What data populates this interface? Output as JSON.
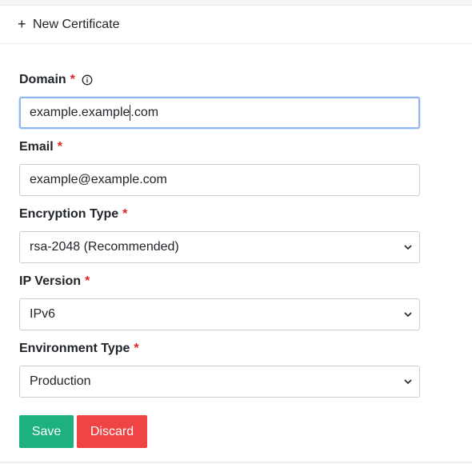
{
  "header": {
    "plus_icon": "plus-icon",
    "title": "New Certificate"
  },
  "form": {
    "domain": {
      "label": "Domain",
      "required_mark": "*",
      "info_icon": "info-circle-icon",
      "value_before_caret": "example.example",
      "value_after_caret": ".com"
    },
    "email": {
      "label": "Email",
      "required_mark": "*",
      "value": "example@example.com"
    },
    "encryption_type": {
      "label": "Encryption Type",
      "required_mark": "*",
      "selected": "rsa-2048 (Recommended)"
    },
    "ip_version": {
      "label": "IP Version",
      "required_mark": "*",
      "selected": "IPv6"
    },
    "environment_type": {
      "label": "Environment Type",
      "required_mark": "*",
      "selected": "Production"
    }
  },
  "actions": {
    "save_label": "Save",
    "discard_label": "Discard"
  },
  "colors": {
    "save": "#1db17e",
    "discard": "#ef4344",
    "required": "#e02424",
    "focus_border": "#8fb7f0"
  }
}
